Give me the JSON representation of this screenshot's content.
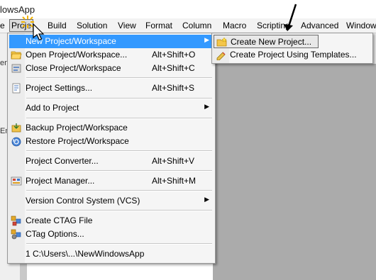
{
  "window": {
    "title": "lowsApp"
  },
  "menubar": {
    "items": [
      {
        "label": "e"
      },
      {
        "label": "Proje"
      },
      {
        "label": "Build"
      },
      {
        "label": "Solution"
      },
      {
        "label": "View"
      },
      {
        "label": "Format"
      },
      {
        "label": "Column"
      },
      {
        "label": "Macro"
      },
      {
        "label": "Scripting"
      },
      {
        "label": "Advanced"
      },
      {
        "label": "Window"
      }
    ]
  },
  "left_panel": {
    "fragments": [
      "en",
      "En"
    ]
  },
  "project_menu": {
    "items": [
      {
        "label": "New Project/Workspace",
        "shortcut": "",
        "submenu": true,
        "highlighted": true,
        "icon": "none"
      },
      {
        "label": "Open Project/Workspace...",
        "shortcut": "Alt+Shift+O",
        "icon": "folder-open-icon"
      },
      {
        "label": "Close Project/Workspace",
        "shortcut": "Alt+Shift+C",
        "icon": "project-close-icon"
      },
      {
        "label": "Project Settings...",
        "shortcut": "Alt+Shift+S",
        "icon": "settings-page-icon"
      },
      {
        "label": "Add to Project",
        "shortcut": "",
        "submenu": true,
        "icon": "none"
      },
      {
        "label": "Backup Project/Workspace",
        "shortcut": "",
        "icon": "backup-icon"
      },
      {
        "label": "Restore Project/Workspace",
        "shortcut": "",
        "icon": "restore-icon"
      },
      {
        "label": "Project Converter...",
        "shortcut": "Alt+Shift+V",
        "icon": "none"
      },
      {
        "label": "Project Manager...",
        "shortcut": "Alt+Shift+M",
        "icon": "project-manager-icon"
      },
      {
        "label": "Version Control System (VCS)",
        "shortcut": "",
        "submenu": true,
        "icon": "none"
      },
      {
        "label": "Create CTAG File",
        "shortcut": "",
        "icon": "ctag-file-icon"
      },
      {
        "label": "CTag Options...",
        "shortcut": "",
        "icon": "ctag-options-icon"
      },
      {
        "label": "1 C:\\Users\\...\\NewWindowsApp",
        "shortcut": "",
        "icon": "none"
      }
    ]
  },
  "new_project_submenu": {
    "items": [
      {
        "label": "Create New Project...",
        "icon": "new-project-icon"
      },
      {
        "label": "Create Project Using Templates...",
        "icon": "template-icon"
      }
    ]
  },
  "colors": {
    "highlight": "#3399ff",
    "menu_bg": "#f5f5f5",
    "workspace_bg": "#ababab"
  }
}
